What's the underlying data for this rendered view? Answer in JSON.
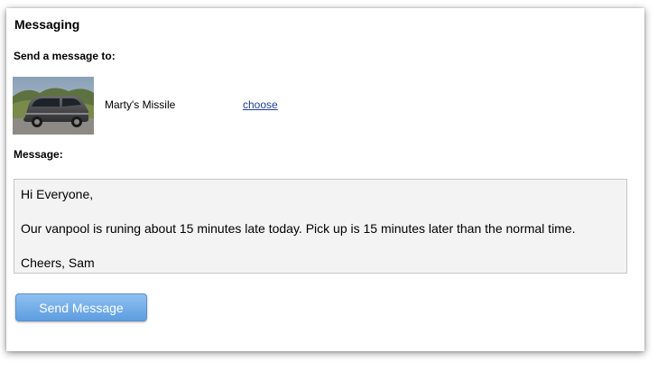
{
  "panel": {
    "title": "Messaging",
    "send_to_label": "Send a message to:",
    "recipient": {
      "image_alt": "minivan",
      "name": "Marty's Missile",
      "choose_link": "choose"
    },
    "message_label": "Message:",
    "message_lines": [
      "Hi Everyone,",
      "Our vanpool is runing about 15 minutes late today.  Pick up is 15 minutes later than the normal time.",
      "Cheers, Sam"
    ],
    "send_button": "Send Message"
  },
  "colors": {
    "link": "#1f3f8f",
    "button_top": "#8fc0f0",
    "button_bottom": "#5d9de0",
    "message_bg": "#f3f3f3"
  }
}
